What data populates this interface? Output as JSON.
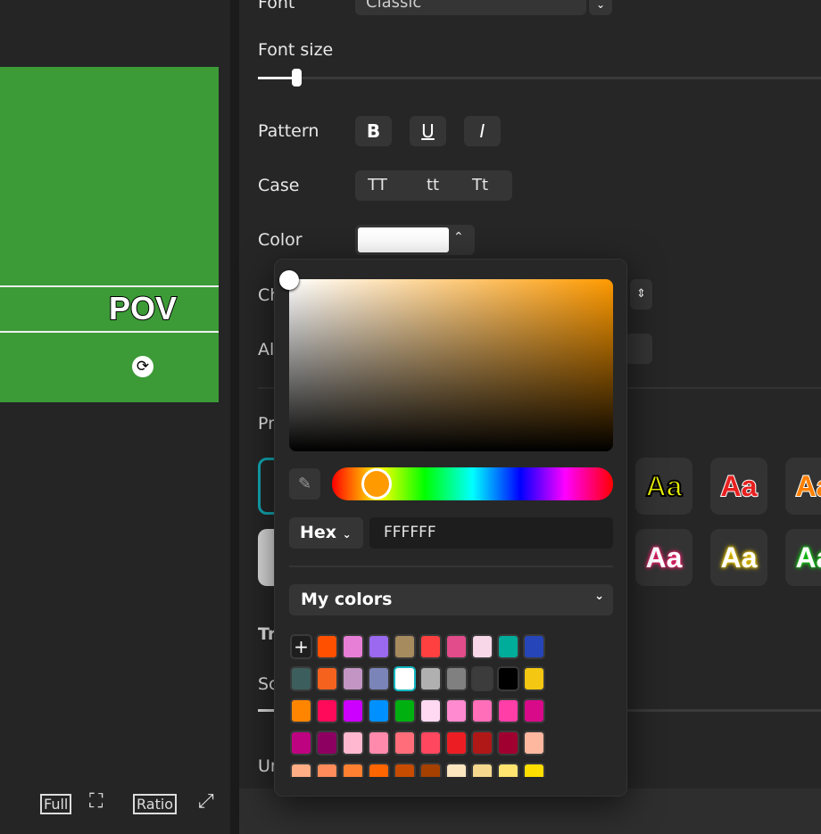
{
  "preview": {
    "caption": "POV",
    "bg": "#3c9b37"
  },
  "toolbar": {
    "full": "Full",
    "ratio": "Ratio"
  },
  "settings": {
    "font_label": "Font",
    "font_value": "Classic",
    "font_size_label": "Font size",
    "font_size_percent": 12,
    "pattern_label": "Pattern",
    "pattern_buttons": [
      "B",
      "U",
      "I"
    ],
    "case_label": "Case",
    "case_buttons": [
      "TT",
      "tt",
      "Tt"
    ],
    "color_label": "Color",
    "color_value": "#FFFFFF",
    "hidden_labels": [
      "Ch",
      "Al",
      "Pr",
      "Tr",
      "Sc",
      "Un"
    ],
    "presets": [
      "Aa",
      "Aa",
      "Aa",
      "Aa",
      "Aa",
      "Aa"
    ]
  },
  "picker": {
    "mode": "Hex",
    "hex_value": "FFFFFF",
    "hue_color": "#ff9a00",
    "my_colors_label": "My colors",
    "add": "+",
    "swatches": [
      "#ff5000",
      "#e87fd6",
      "#9b68f0",
      "#a58b5e",
      "#ff4040",
      "#e24c8a",
      "#f8d7e8",
      "#00ad9b",
      "#2545b8",
      "#3c5e5c",
      "#f5621e",
      "#c395c4",
      "#7b84b8",
      "#ffffff",
      "#b0b0b0",
      "#808080",
      "#3c3c3c",
      "#000000",
      "#f3c712",
      "#ff8500",
      "#ff0a5a",
      "#cc00ff",
      "#0090ff",
      "#00b010",
      "#ffd8f2",
      "#ff8ad0",
      "#ff6eb8",
      "#ff3ea8",
      "#d80a8a",
      "#bd0380",
      "#8d0061",
      "#ffb8d0",
      "#ff8aac",
      "#ff6d7a",
      "#ff4760",
      "#ec1e24",
      "#b01818",
      "#a00030",
      "#ffb8a0",
      "#ffad85",
      "#ff8c5a",
      "#ff8030",
      "#ff6500",
      "#c84c00",
      "#a54000",
      "#fbe6c0",
      "#f5d88e",
      "#ffe470",
      "#ffde00"
    ]
  }
}
